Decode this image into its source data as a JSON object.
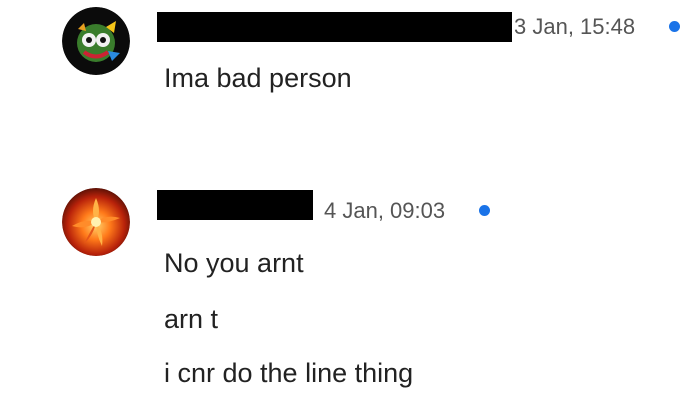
{
  "messages": [
    {
      "avatar_icon": "game-character-avatar-icon",
      "timestamp": "3 Jan, 15:48",
      "unread_color": "#1a73e8",
      "lines": [
        "Ima bad person"
      ]
    },
    {
      "avatar_icon": "fire-flower-avatar-icon",
      "timestamp": "4 Jan, 09:03",
      "unread_color": "#1a73e8",
      "lines": [
        "No you arnt",
        "arn t",
        "i cnr do the line thing"
      ]
    }
  ]
}
